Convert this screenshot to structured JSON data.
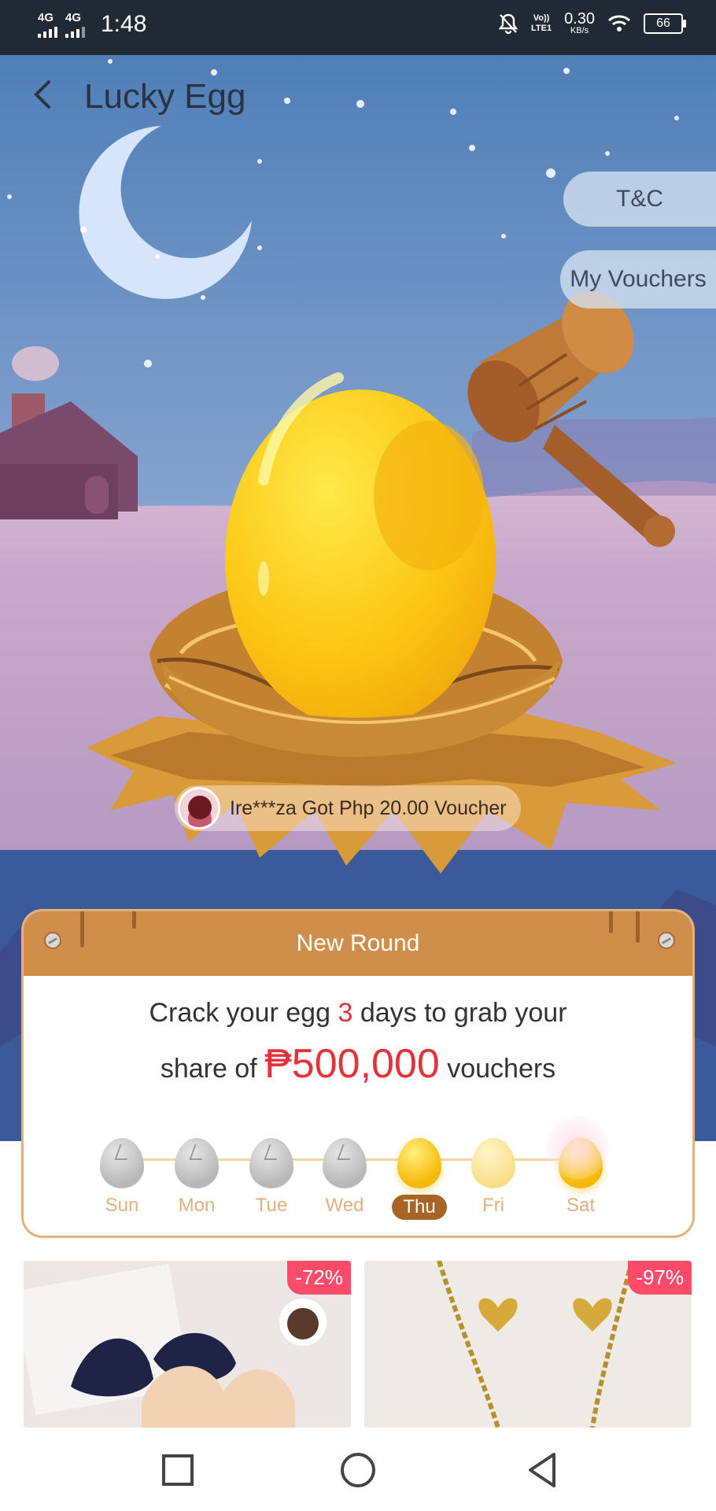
{
  "status_bar": {
    "network1": "4G",
    "network2": "4G",
    "time": "1:48",
    "volte_line1": "Vo))",
    "volte_line2": "LTE1",
    "speed_value": "0.30",
    "speed_unit": "KB/s",
    "battery": "66"
  },
  "header": {
    "title": "Lucky Egg"
  },
  "side_buttons": {
    "tc": "T&C",
    "vouchers": "My Vouchers"
  },
  "winner": {
    "text": "Ire***za Got Php 20.00 Voucher"
  },
  "round_card": {
    "header": "New Round",
    "line1_prefix": "Crack your egg ",
    "line1_days": "3",
    "line1_suffix": " days to grab your",
    "line2_prefix": "share of ",
    "line2_amount": "₱500,000",
    "line2_suffix": " vouchers",
    "days": [
      {
        "label": "Sun",
        "state": "cracked"
      },
      {
        "label": "Mon",
        "state": "cracked"
      },
      {
        "label": "Tue",
        "state": "cracked"
      },
      {
        "label": "Wed",
        "state": "cracked"
      },
      {
        "label": "Thu",
        "state": "today"
      },
      {
        "label": "Fri",
        "state": "upcoming"
      },
      {
        "label": "Sat",
        "state": "prize"
      }
    ]
  },
  "products": [
    {
      "discount": "-72%"
    },
    {
      "discount": "-97%"
    }
  ],
  "colors": {
    "accent": "#cf8e49",
    "price_red": "#e4323a",
    "badge": "#ff4b6a"
  }
}
